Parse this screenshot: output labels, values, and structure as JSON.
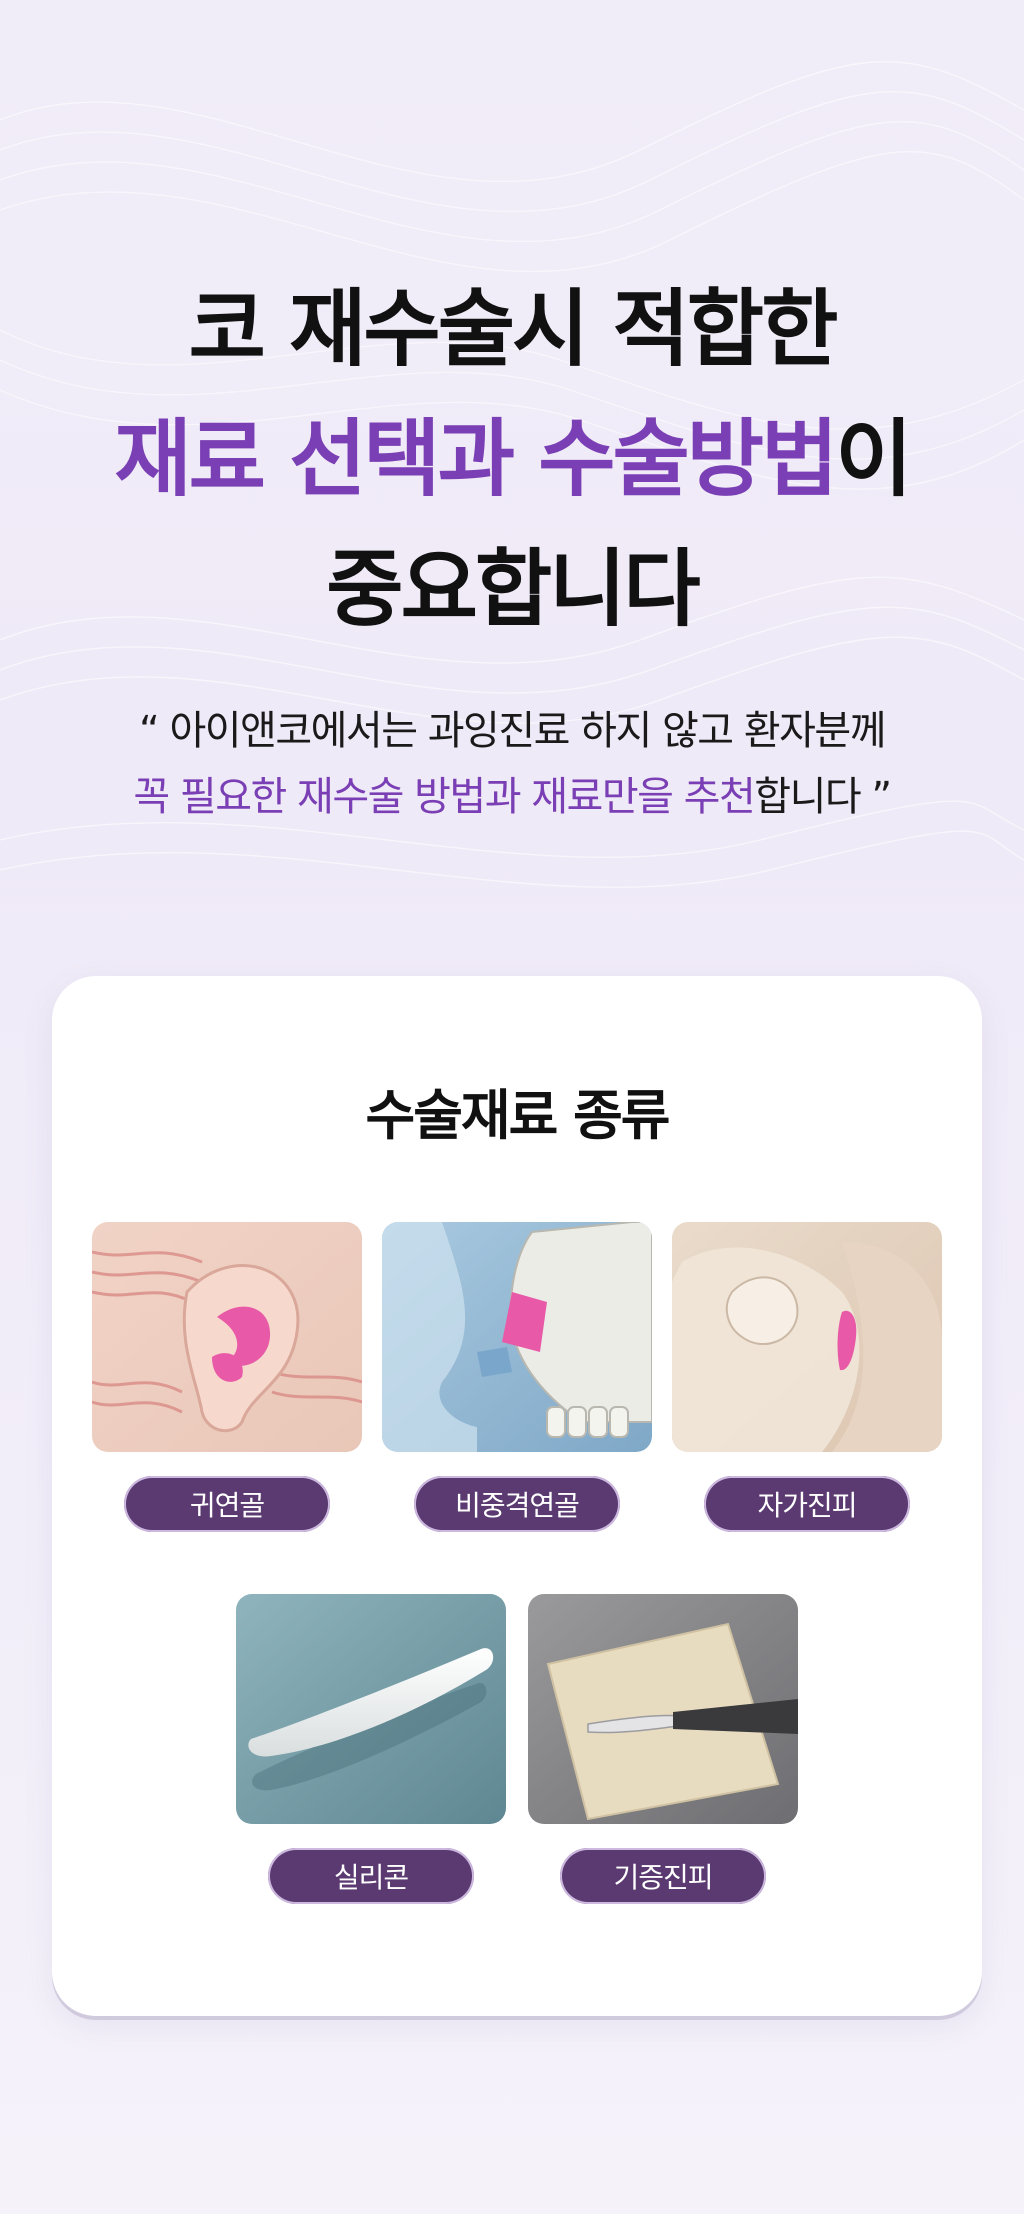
{
  "headline": {
    "line1": "코 재수술시 적합한",
    "line2_highlight": "재료 선택과 수술방법",
    "line2_rest": "이",
    "line3": "중요합니다"
  },
  "quote": {
    "line1": "“ 아이앤코에서는 과잉진료 하지 않고 환자분께",
    "line2_highlight": "꼭 필요한 재수술 방법과 재료만을 추천",
    "line2_rest": "합니다 ”"
  },
  "materials": {
    "title": "수술재료 종류",
    "items": [
      {
        "label": "귀연골",
        "icon": "ear-cartilage-illustration"
      },
      {
        "label": "비중격연골",
        "icon": "septal-cartilage-illustration"
      },
      {
        "label": "자가진피",
        "icon": "dermis-illustration"
      },
      {
        "label": "실리콘",
        "icon": "silicone-implant-photo"
      },
      {
        "label": "기증진피",
        "icon": "donor-dermis-photo"
      }
    ]
  },
  "colors": {
    "accent": "#7a3fb4",
    "pill": "#5a3a70",
    "highlight": "#e05aa8"
  }
}
